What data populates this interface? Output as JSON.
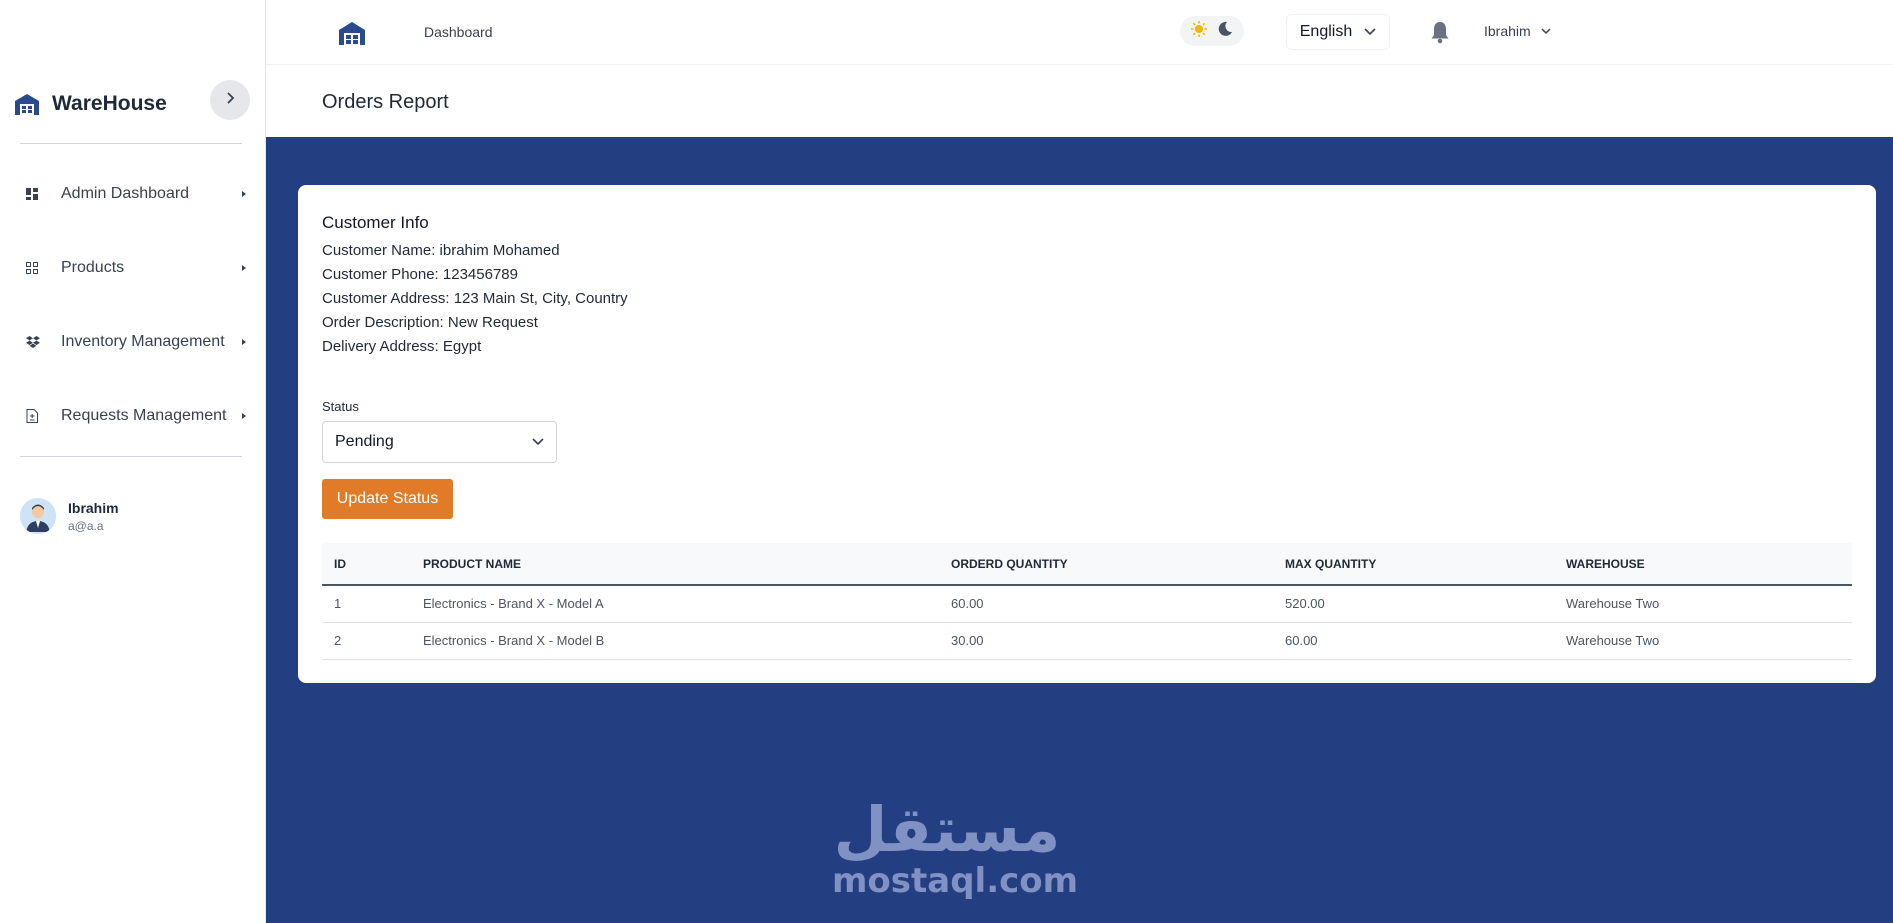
{
  "sidebar": {
    "brand": "WareHouse",
    "items": [
      {
        "label": "Admin Dashboard",
        "icon": "dashboard-icon"
      },
      {
        "label": "Products",
        "icon": "grid-icon"
      },
      {
        "label": "Inventory Management",
        "icon": "dropbox-icon"
      },
      {
        "label": "Requests Management",
        "icon": "document-icon"
      }
    ],
    "user": {
      "name": "Ibrahim",
      "email": "a@a.a"
    }
  },
  "topbar": {
    "breadcrumb": "Dashboard",
    "language": "English",
    "user_name": "Ibrahim"
  },
  "page": {
    "title": "Orders Report"
  },
  "customer_info": {
    "title": "Customer Info",
    "name": "Customer Name: ibrahim Mohamed",
    "phone": "Customer Phone: 123456789",
    "address": "Customer Address: 123 Main St, City, Country",
    "description": "Order Description: New Request",
    "delivery": "Delivery Address: Egypt"
  },
  "status": {
    "label": "Status",
    "selected": "Pending",
    "button": "Update Status"
  },
  "table": {
    "headers": [
      "ID",
      "PRODUCT NAME",
      "ORDERD QUANTITY",
      "MAX QUANTITY",
      "WAREHOUSE"
    ],
    "rows": [
      [
        "1",
        "Electronics - Brand X - Model A",
        "60.00",
        "520.00",
        "Warehouse Two"
      ],
      [
        "2",
        "Electronics - Brand X - Model B",
        "30.00",
        "60.00",
        "Warehouse Two"
      ]
    ]
  },
  "watermark": {
    "arabic": "مستقل",
    "latin": "mostaql.com"
  },
  "colors": {
    "content_bg": "#243e82",
    "accent": "#e27b28",
    "brand_icon": "#2a4a8c"
  }
}
